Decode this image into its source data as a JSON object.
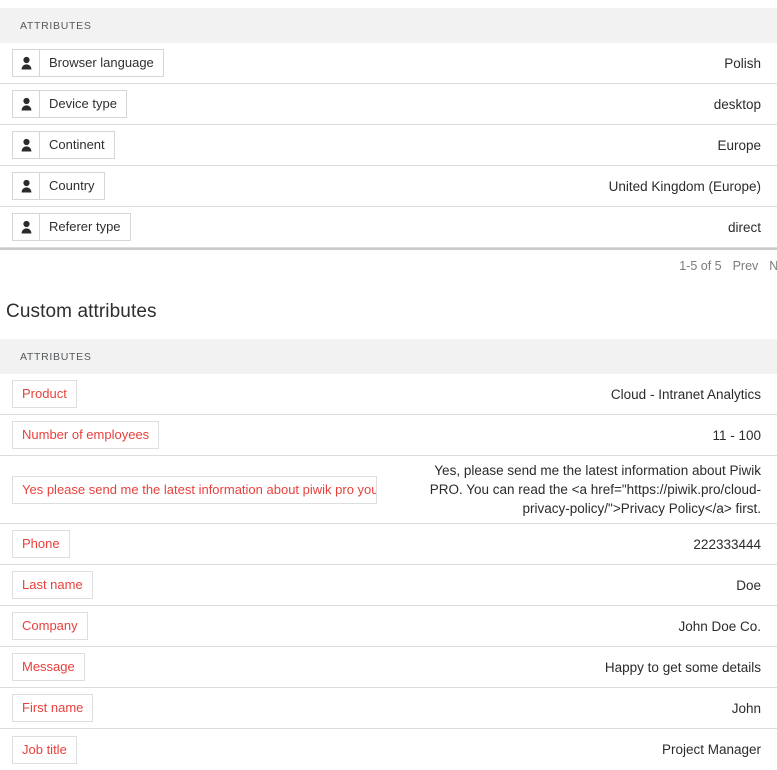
{
  "standard_section": {
    "header_label": "ATTRIBUTES",
    "rows": [
      {
        "icon": "person-icon",
        "name": "Browser language",
        "value": "Polish"
      },
      {
        "icon": "person-icon",
        "name": "Device type",
        "value": "desktop"
      },
      {
        "icon": "person-icon",
        "name": "Continent",
        "value": "Europe"
      },
      {
        "icon": "person-icon",
        "name": "Country",
        "value": "United Kingdom (Europe)"
      },
      {
        "icon": "person-icon",
        "name": "Referer type",
        "value": "direct"
      }
    ],
    "pagination": {
      "range": "1-5 of 5",
      "prev_label": "Prev",
      "next_label": "Next"
    }
  },
  "custom_section": {
    "title": "Custom attributes",
    "header_label": "ATTRIBUTES",
    "rows": [
      {
        "name": "Product",
        "value": "Cloud - Intranet Analytics"
      },
      {
        "name": "Number of employees",
        "value": "11 - 100"
      },
      {
        "name": "Yes please send me the latest information about piwik pro you …",
        "value": "Yes, please send me the latest information about Piwik PRO. You can read the <a href=\"https://piwik.pro/cloud-privacy-policy/\">Privacy Policy</a> first."
      },
      {
        "name": "Phone",
        "value": "222333444"
      },
      {
        "name": "Last name",
        "value": "Doe"
      },
      {
        "name": "Company",
        "value": "John Doe Co."
      },
      {
        "name": "Message",
        "value": "Happy to get some details"
      },
      {
        "name": "First name",
        "value": "John"
      },
      {
        "name": "Job title",
        "value": "Project Manager"
      }
    ]
  },
  "colors": {
    "custom_label": "#e8413c",
    "header_bg": "#f2f2f2",
    "text": "#2b2b2b",
    "muted": "#7b7b7b"
  }
}
